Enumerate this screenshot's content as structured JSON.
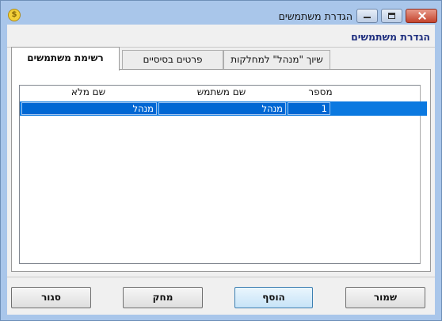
{
  "window": {
    "title": "הגדרת משתמשים"
  },
  "section_title": "הגדרת משתמשים",
  "tabs": [
    {
      "label": "רשימת משתמשים",
      "active": true
    },
    {
      "label": "פרטים בסיסיים",
      "active": false
    },
    {
      "label": "שיוך \"מנהל\" למחלקות",
      "active": false
    }
  ],
  "grid": {
    "columns": [
      "שם מלא",
      "שם משתמש",
      "מספר"
    ],
    "rows": [
      {
        "full_name": "מנהל",
        "username": "מנהל",
        "number": "1"
      }
    ]
  },
  "buttons": {
    "close": "סגור",
    "delete": "מחק",
    "add": "הוסף",
    "save": "שמור"
  },
  "colors": {
    "selection": "#0b79e0",
    "title_text": "#1f2f7f"
  }
}
